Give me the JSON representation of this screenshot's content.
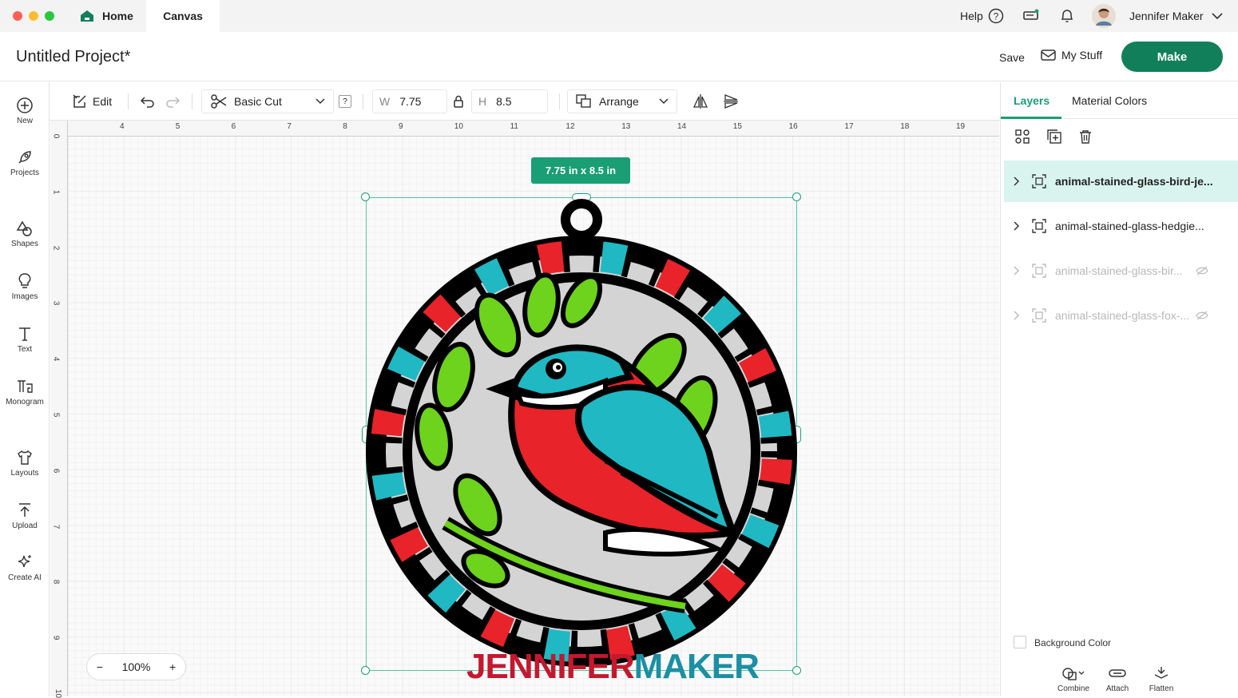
{
  "window": {
    "tabs": [
      {
        "label": "Home"
      },
      {
        "label": "Canvas"
      }
    ],
    "help_label": "Help",
    "user_name": "Jennifer Maker"
  },
  "project": {
    "title": "Untitled Project*",
    "save_label": "Save",
    "mystuff_label": "My Stuff",
    "make_label": "Make"
  },
  "sidebar": {
    "items": [
      {
        "label": "New",
        "icon": "plus-circle-icon"
      },
      {
        "label": "Projects",
        "icon": "rocket-icon"
      },
      {
        "label": "Shapes",
        "icon": "shapes-icon"
      },
      {
        "label": "Images",
        "icon": "lightbulb-icon"
      },
      {
        "label": "Text",
        "icon": "text-icon"
      },
      {
        "label": "Monogram",
        "icon": "monogram-icon"
      },
      {
        "label": "Layouts",
        "icon": "shirt-icon"
      },
      {
        "label": "Upload",
        "icon": "upload-icon"
      },
      {
        "label": "Create AI",
        "icon": "sparkle-icon"
      }
    ]
  },
  "toolbar": {
    "edit_label": "Edit",
    "operation": "Basic Cut",
    "help_badge": "?",
    "width_label": "W",
    "width_value": "7.75",
    "height_label": "H",
    "height_value": "8.5",
    "arrange_label": "Arrange"
  },
  "canvas": {
    "size_badge": "7.75 in x 8.5 in",
    "zoom": "100%",
    "zoom_minus": "−",
    "zoom_plus": "+",
    "ruler_x": [
      "4",
      "5",
      "6",
      "7",
      "8",
      "9",
      "10",
      "11",
      "12",
      "13",
      "14",
      "15",
      "16",
      "17",
      "18",
      "19"
    ],
    "ruler_y": [
      "0",
      "1",
      "2",
      "3",
      "4",
      "5",
      "6",
      "7",
      "8",
      "9",
      "10"
    ],
    "watermark_part1": "JENNIFER",
    "watermark_part2": "MAKER"
  },
  "panel": {
    "tabs": [
      {
        "label": "Layers"
      },
      {
        "label": "Material Colors"
      }
    ],
    "layers": [
      {
        "name": "animal-stained-glass-bird-je...",
        "selected": true,
        "hidden": false
      },
      {
        "name": "animal-stained-glass-hedgie...",
        "selected": false,
        "hidden": false
      },
      {
        "name": "animal-stained-glass-bir...",
        "selected": false,
        "hidden": true
      },
      {
        "name": "animal-stained-glass-fox-...",
        "selected": false,
        "hidden": true
      }
    ],
    "background_color_label": "Background Color",
    "bottom_actions": [
      {
        "label": "Combine",
        "enabled": true
      },
      {
        "label": "Attach",
        "enabled": true
      },
      {
        "label": "Flatten",
        "enabled": true
      }
    ]
  },
  "colors": {
    "accent": "#1a9e74",
    "make_button": "#11805a",
    "selected_layer": "#d9f4ee",
    "bird_red": "#e8232a",
    "bird_teal": "#1fb8c3",
    "leaf_green": "#6ed31c",
    "glass_gray": "#d4d4d4"
  }
}
